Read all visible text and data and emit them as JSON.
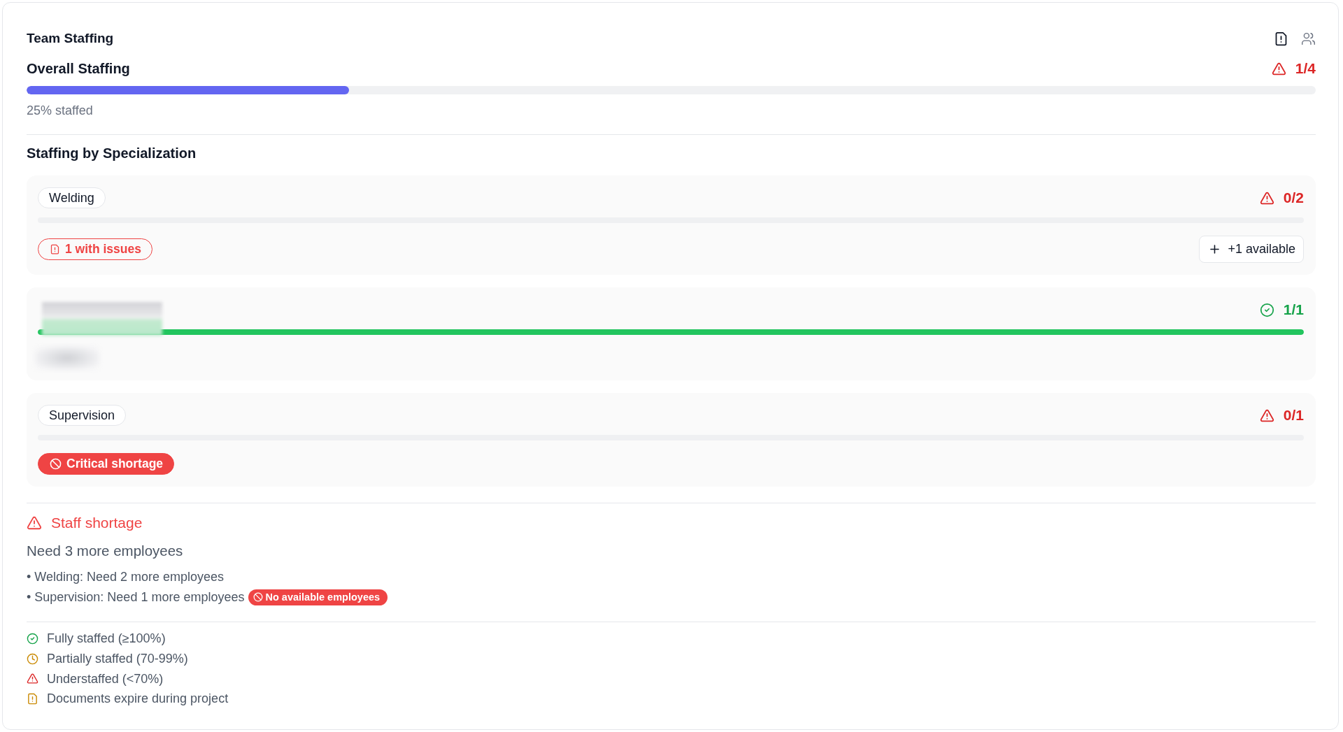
{
  "header": {
    "title": "Team Staffing",
    "view_toggles": [
      {
        "kind": "documents",
        "selected": true
      },
      {
        "kind": "team",
        "selected": false
      }
    ]
  },
  "overall": {
    "title": "Overall Staffing",
    "fully_staffed": false,
    "count": "1/4",
    "level": 0.25,
    "caption": "25% staffed"
  },
  "section_title": "Staffing by Specialization",
  "specializations": [
    {
      "name": "Welding",
      "blurred": false,
      "fully_staffed": false,
      "count": "0/2",
      "badges": [
        {
          "kind": "issues",
          "label": "1 with issues"
        }
      ],
      "action": "+1 available"
    },
    {
      "blurred": true,
      "fully_staffed": true,
      "count": "1/1",
      "level": 1
    },
    {
      "name": "Supervision",
      "blurred": false,
      "fully_staffed": false,
      "count": "0/1",
      "badges": [
        {
          "kind": "critical",
          "label": "Critical shortage"
        }
      ]
    }
  ],
  "alert": {
    "title": "Staff shortage",
    "summary": "Need 3 more employees",
    "items": [
      {
        "text": "• Welding: Need 2 more employees"
      },
      {
        "text": "• Supervision: Need 1 more employees",
        "badge": "No available employees"
      }
    ]
  },
  "legend": [
    {
      "kind": "full",
      "label": "Fully staffed (≥100%)"
    },
    {
      "kind": "partial",
      "label": "Partially staffed (70-99%)"
    },
    {
      "kind": "under",
      "label": "Understaffed (<70%)"
    },
    {
      "kind": "expiring",
      "label": "Documents expire during project"
    }
  ]
}
